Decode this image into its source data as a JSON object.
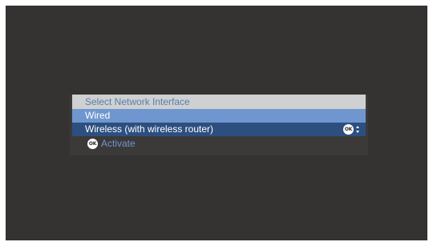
{
  "dialog": {
    "title": "Select Network Interface",
    "items": [
      {
        "label": "Wired",
        "state": "highlighted"
      },
      {
        "label": "Wireless (with wireless router)",
        "state": "selected"
      }
    ]
  },
  "hints": {
    "ok_badge": "OK",
    "activate_label": "Activate"
  },
  "icons": {
    "ok": "ok-button-icon",
    "updown": "up-down-arrows-icon"
  },
  "colors": {
    "background": "#353232",
    "title_bar": "#cfd0d1",
    "title_text": "#5a7eaa",
    "highlight": "#6f96cf",
    "selected": "#2c4f80",
    "hint_text": "#6f96cf"
  }
}
